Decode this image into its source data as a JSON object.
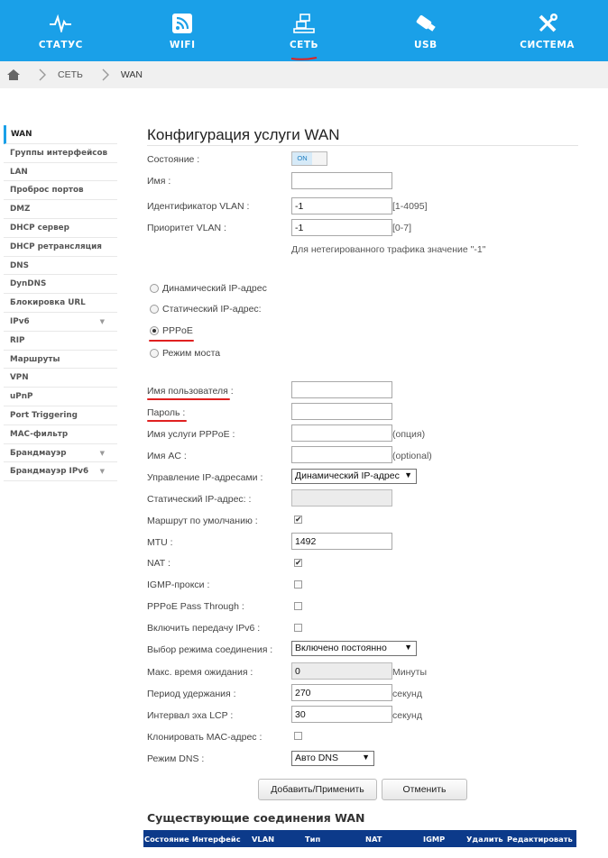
{
  "nav": {
    "status": "СТАТУС",
    "wifi": "WIFI",
    "network": "СЕТЬ",
    "usb": "USB",
    "system": "СИСТЕМА",
    "active_color": "#ffffff",
    "underline_color": "#e02020"
  },
  "breadcrumb": {
    "level1": "СЕТЬ",
    "current": "WAN"
  },
  "sidebar": {
    "items": [
      {
        "label": "WAN"
      },
      {
        "label": "Группы интерфейсов"
      },
      {
        "label": "LAN"
      },
      {
        "label": "Проброс портов"
      },
      {
        "label": "DMZ"
      },
      {
        "label": "DHCP сервер"
      },
      {
        "label": "DHCP ретрансляция"
      },
      {
        "label": "DNS"
      },
      {
        "label": "DynDNS"
      },
      {
        "label": "Блокировка URL"
      },
      {
        "label": "IPv6"
      },
      {
        "label": "RIP"
      },
      {
        "label": "Маршруты"
      },
      {
        "label": "VPN"
      },
      {
        "label": "uPnP"
      },
      {
        "label": "Port Triggering"
      },
      {
        "label": "MAC-фильтр"
      },
      {
        "label": "Брандмауэр"
      },
      {
        "label": "Брандмауэр IPv6"
      }
    ],
    "expand_arrow": "▼"
  },
  "form": {
    "title": "Конфигурация услуги WAN",
    "state_label": "Состояние :",
    "state_value": "ON",
    "name_label": "Имя :",
    "name_value": "",
    "vlan_id_label": "Идентификатор VLAN :",
    "vlan_id_value": "-1",
    "vlan_id_range": "[1-4095]",
    "vlan_prio_label": "Приоритет VLAN :",
    "vlan_prio_value": "-1",
    "vlan_prio_range": "[0-7]",
    "vlan_note": "Для нетегированного трафика значение \"-1\"",
    "mode_dynamic": "Динамический IP-адрес",
    "mode_static": "Статический IP-адрес:",
    "mode_pppoe": "PPPoE",
    "mode_bridge": "Режим моста",
    "username_label": "Имя пользователя :",
    "username_value": "",
    "password_label": "Пароль :",
    "password_value": "",
    "service_label": "Имя услуги PPPoE :",
    "service_value": "",
    "service_hint": "(опция)",
    "ac_label": "Имя AC :",
    "ac_value": "",
    "ac_hint": "(optional)",
    "ipmgmt_label": "Управление IP-адресами :",
    "ipmgmt_value": "Динамический IP-адрес",
    "static_ip_label": "Статический IP-адрес: :",
    "static_ip_value": "",
    "default_route_label": "Маршрут по умолчанию :",
    "default_route_checked": true,
    "mtu_label": "MTU :",
    "mtu_value": "1492",
    "nat_label": "NAT :",
    "nat_checked": true,
    "igmp_label": "IGMP-прокси :",
    "igmp_checked": false,
    "passthrough_label": "PPPoE Pass Through :",
    "passthrough_checked": false,
    "ipv6_label": "Включить передачу IPv6 :",
    "ipv6_checked": false,
    "conn_mode_label": "Выбор режима соединения :",
    "conn_mode_value": "Включено постоянно",
    "idle_label": "Макс. время ожидания :",
    "idle_value": "0",
    "idle_unit": "Минуты",
    "hold_label": "Период удержания :",
    "hold_value": "270",
    "hold_unit": "секунд",
    "lcp_label": "Интервал эха LCP :",
    "lcp_value": "30",
    "lcp_unit": "секунд",
    "clone_mac_label": "Клонировать MAC-адрес :",
    "clone_mac_checked": false,
    "dns_label": "Режим DNS :",
    "dns_value": "Авто DNS",
    "check_mark": "✔"
  },
  "buttons": {
    "apply": "Добавить/Применить",
    "cancel": "Отменить"
  },
  "connections": {
    "title": "Существующие соединения WAN",
    "columns": [
      "Состояние",
      "Интерфейс",
      "VLAN",
      "Тип",
      "NAT",
      "IGMP",
      "Удалить",
      "Редактировать"
    ]
  },
  "colors": {
    "accent": "#1aa0e8",
    "table_header": "#0c3a8a",
    "annotation_red": "#e02020"
  }
}
